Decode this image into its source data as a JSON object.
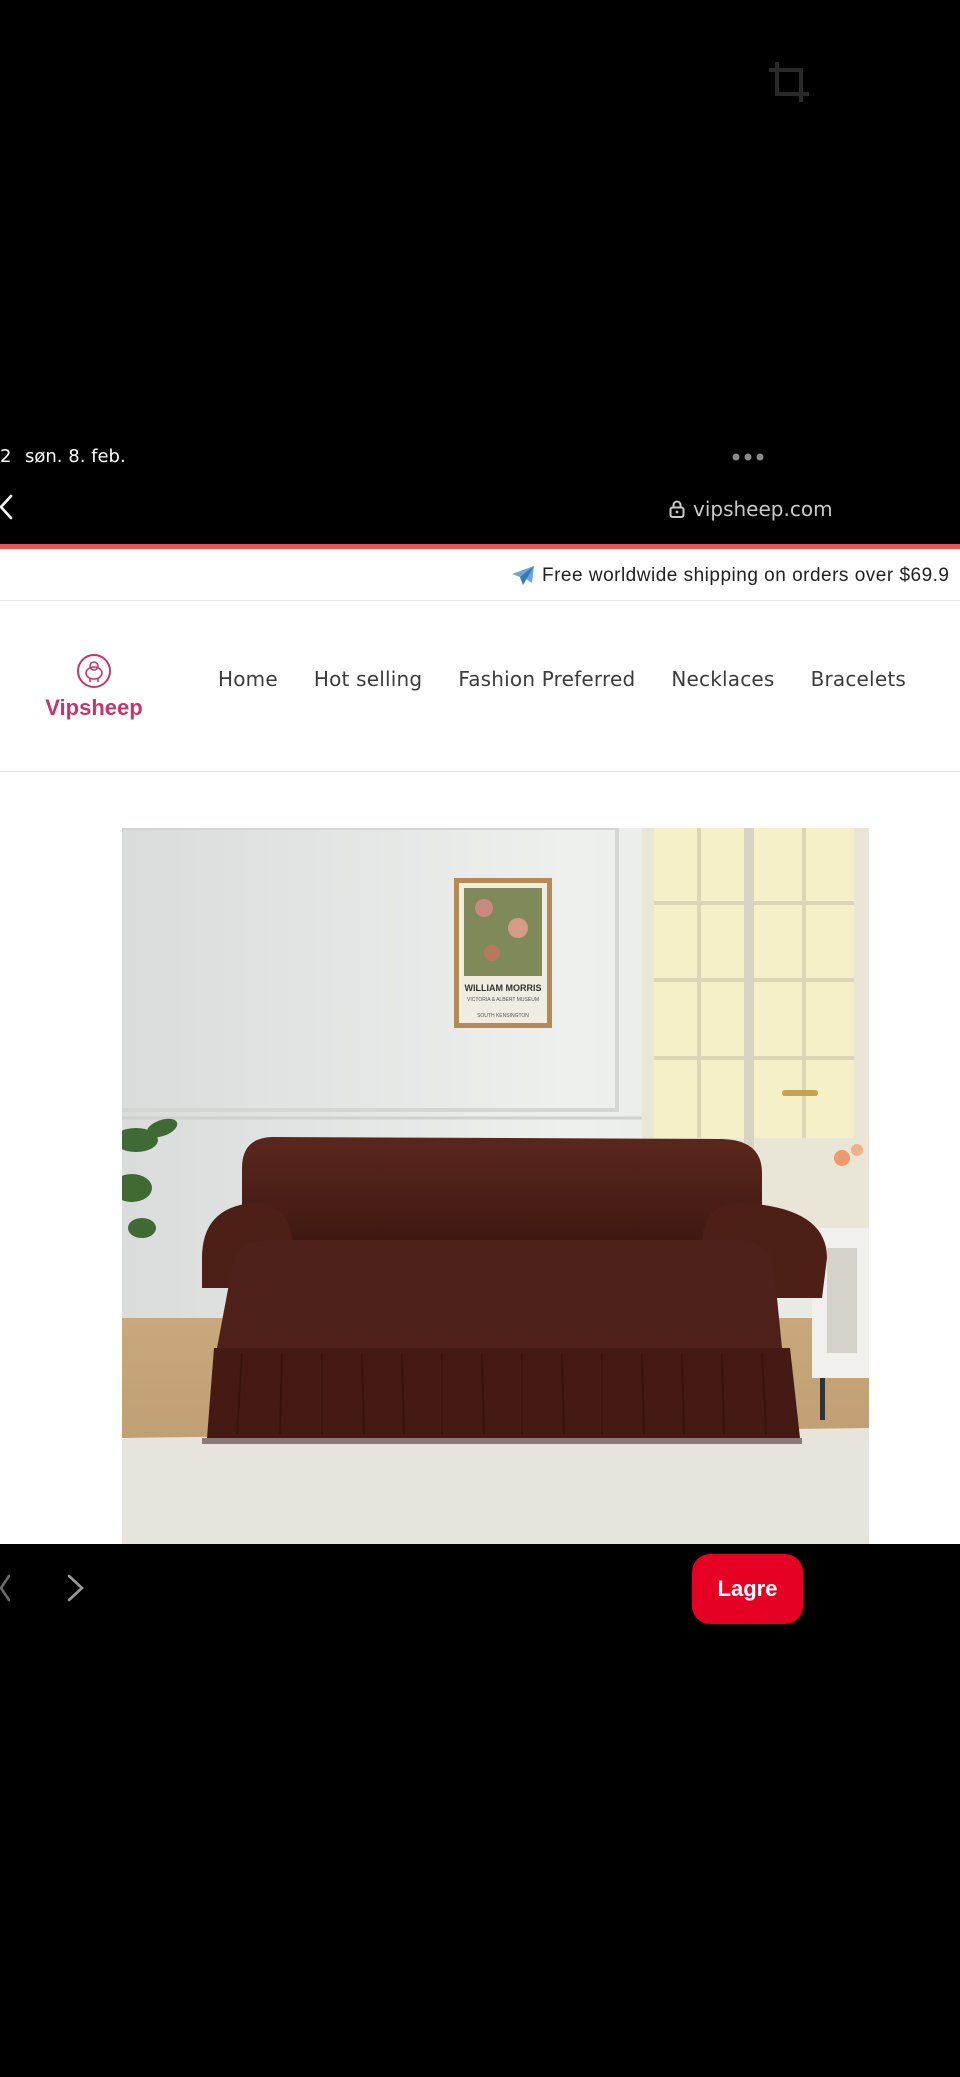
{
  "status": {
    "time_fragment": "2",
    "date": "søn. 8. feb."
  },
  "browser": {
    "url": "vipsheep.com"
  },
  "announcement": {
    "text": "Free worldwide shipping on orders over $69.9"
  },
  "store": {
    "logo_text": "Vipsheep",
    "nav": [
      "Home",
      "Hot selling",
      "Fashion Preferred",
      "Necklaces",
      "Bracelets"
    ]
  },
  "product_image": {
    "poster_title": "WILLIAM MORRIS",
    "poster_sub1": "VICTORIA & ALBERT MUSEUM",
    "poster_sub2": "SOUTH KENSINGTON"
  },
  "bottom_bar": {
    "save_label": "Lagre"
  },
  "colors": {
    "accent_red": "#e60023",
    "brand_pink": "#c5356f",
    "progress": "#e8585a",
    "sofa": "#4e2018"
  },
  "icons": [
    "crop-icon",
    "more-dots-icon",
    "back-chevron-icon",
    "lock-icon",
    "airplane-icon",
    "prev-chevron-icon",
    "next-chevron-icon"
  ]
}
